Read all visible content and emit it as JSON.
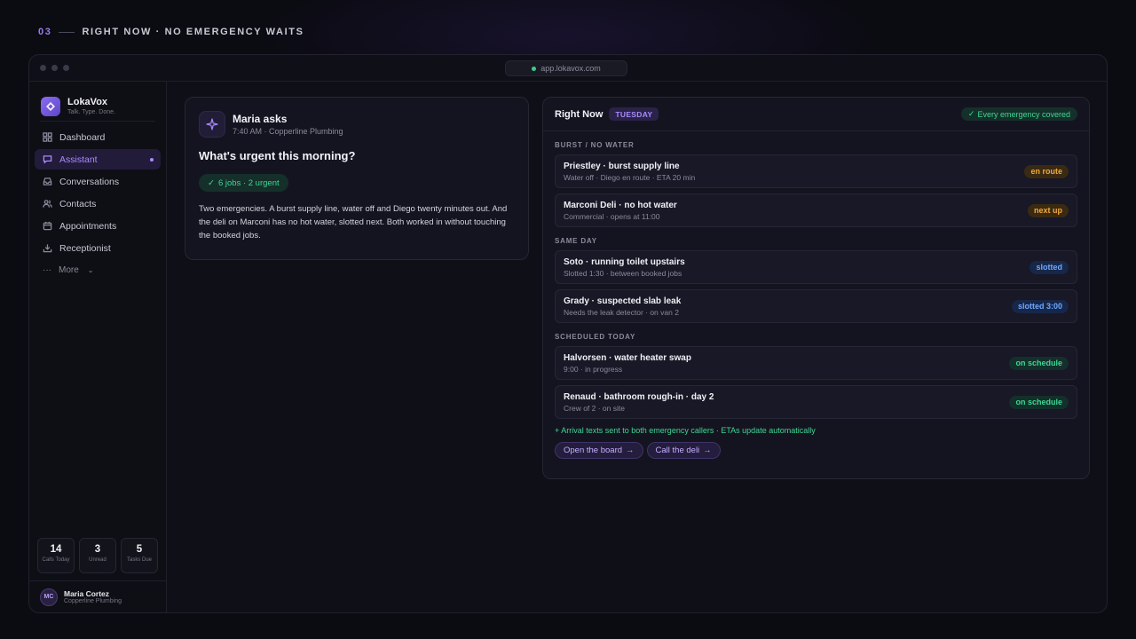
{
  "eyebrow": {
    "number": "03",
    "text": "RIGHT NOW · NO EMERGENCY WAITS"
  },
  "browser": {
    "url": "app.lokavox.com"
  },
  "brand": {
    "name": "LokaVox",
    "tagline": "Talk. Type. Done."
  },
  "sidebar": {
    "items": [
      {
        "label": "Dashboard",
        "icon": "grid-icon"
      },
      {
        "label": "Assistant",
        "icon": "chat-icon"
      },
      {
        "label": "Conversations",
        "icon": "inbox-icon"
      },
      {
        "label": "Contacts",
        "icon": "users-icon"
      },
      {
        "label": "Appointments",
        "icon": "calendar-icon"
      },
      {
        "label": "Receptionist",
        "icon": "download-icon"
      }
    ],
    "more_label": "More",
    "stats": [
      {
        "value": "14",
        "label": "Calls Today"
      },
      {
        "value": "3",
        "label": "Unread"
      },
      {
        "value": "5",
        "label": "Tasks Due"
      }
    ],
    "user": {
      "initials": "MC",
      "name": "Maria Cortez",
      "org": "Copperline Plumbing"
    }
  },
  "ask": {
    "title": "Maria asks",
    "meta": "7:40 AM · Copperline Plumbing",
    "question": "What's urgent this morning?",
    "badge": "6 jobs · 2 urgent",
    "answer": "Two emergencies. A burst supply line, water off and Diego twenty minutes out. And the deli on Marconi has no hot water, slotted next. Both worked in without touching the booked jobs."
  },
  "right_now": {
    "title": "Right Now",
    "day": "TUESDAY",
    "covered": "Every emergency covered",
    "groups": [
      {
        "label": "BURST / NO WATER",
        "rows": [
          {
            "title": "Priestley · burst supply line",
            "sub": "Water off · Diego en route · ETA 20 min",
            "status": "en route",
            "tone": "amber"
          },
          {
            "title": "Marconi Deli · no hot water",
            "sub": "Commercial · opens at 11:00",
            "status": "next up",
            "tone": "amber"
          }
        ]
      },
      {
        "label": "SAME DAY",
        "rows": [
          {
            "title": "Soto · running toilet upstairs",
            "sub": "Slotted 1:30 · between booked jobs",
            "status": "slotted",
            "tone": "blue"
          },
          {
            "title": "Grady · suspected slab leak",
            "sub": "Needs the leak detector · on van 2",
            "status": "slotted 3:00",
            "tone": "blue"
          }
        ]
      },
      {
        "label": "SCHEDULED TODAY",
        "rows": [
          {
            "title": "Halvorsen · water heater swap",
            "sub": "9:00 · in progress",
            "status": "on schedule",
            "tone": "green"
          },
          {
            "title": "Renaud · bathroom rough-in · day 2",
            "sub": "Crew of 2 · on site",
            "status": "on schedule",
            "tone": "green"
          }
        ]
      }
    ],
    "note": "+ Arrival texts sent to both emergency callers · ETAs update automatically",
    "actions": [
      "Open the board",
      "Call the deli"
    ]
  }
}
